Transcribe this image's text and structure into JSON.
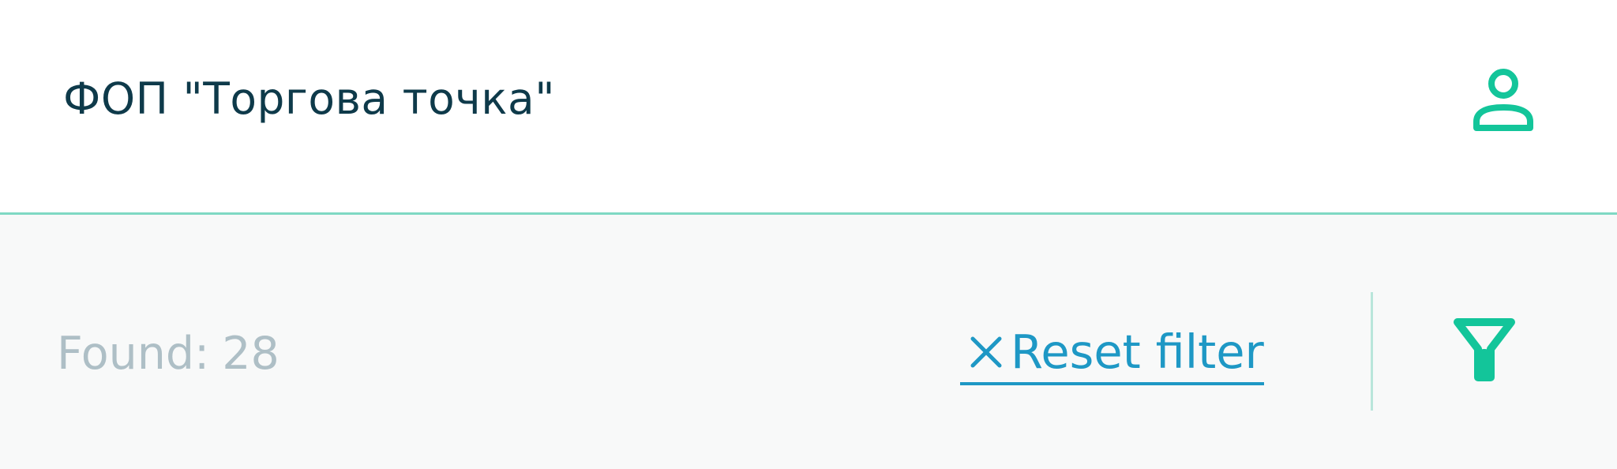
{
  "header": {
    "business_name": "ФОП \"Торгова точка\"",
    "profile_icon": "user-profile-icon"
  },
  "toolbar": {
    "found_label": "Found:",
    "found_count": "28",
    "reset_filter_label": "Reset filter",
    "reset_icon": "close-icon",
    "filter_icon": "filter-funnel-icon"
  },
  "colors": {
    "accent_green": "#13c59a",
    "link_blue": "#1e98c5",
    "title_text": "#0e3a4a",
    "muted_text": "#aebfc6",
    "header_border": "#7fd9c4",
    "toolbar_bg": "#f8f9f9"
  }
}
